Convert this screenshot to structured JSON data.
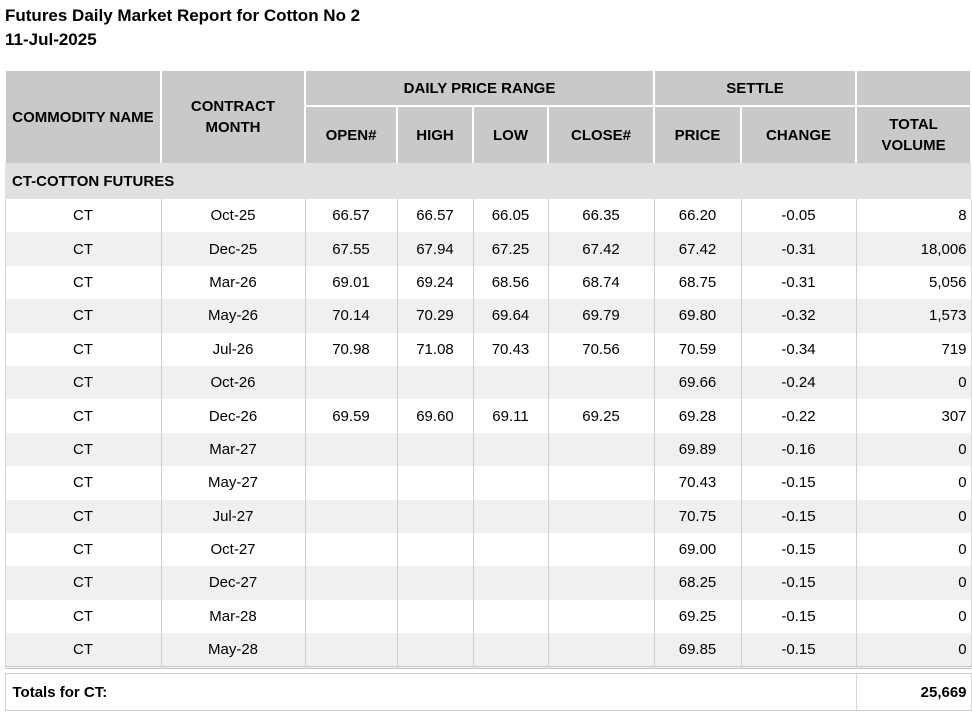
{
  "report": {
    "title": "Futures Daily Market Report for Cotton No 2",
    "date": "11-Jul-2025"
  },
  "table": {
    "headers": {
      "commodity_name": "COMMODITY NAME",
      "contract_month": "CONTRACT MONTH",
      "daily_price_range": "DAILY PRICE RANGE",
      "settle": "SETTLE",
      "total_volume": "TOTAL VOLUME",
      "open": "OPEN#",
      "high": "HIGH",
      "low": "LOW",
      "close": "CLOSE#",
      "price": "PRICE",
      "change": "CHANGE"
    },
    "section_label": "CT-COTTON FUTURES",
    "rows": [
      {
        "commodity": "CT",
        "month": "Oct-25",
        "open": "66.57",
        "high": "66.57",
        "low": "66.05",
        "close": "66.35",
        "price": "66.20",
        "change": "-0.05",
        "volume": "8"
      },
      {
        "commodity": "CT",
        "month": "Dec-25",
        "open": "67.55",
        "high": "67.94",
        "low": "67.25",
        "close": "67.42",
        "price": "67.42",
        "change": "-0.31",
        "volume": "18,006"
      },
      {
        "commodity": "CT",
        "month": "Mar-26",
        "open": "69.01",
        "high": "69.24",
        "low": "68.56",
        "close": "68.74",
        "price": "68.75",
        "change": "-0.31",
        "volume": "5,056"
      },
      {
        "commodity": "CT",
        "month": "May-26",
        "open": "70.14",
        "high": "70.29",
        "low": "69.64",
        "close": "69.79",
        "price": "69.80",
        "change": "-0.32",
        "volume": "1,573"
      },
      {
        "commodity": "CT",
        "month": "Jul-26",
        "open": "70.98",
        "high": "71.08",
        "low": "70.43",
        "close": "70.56",
        "price": "70.59",
        "change": "-0.34",
        "volume": "719"
      },
      {
        "commodity": "CT",
        "month": "Oct-26",
        "open": "",
        "high": "",
        "low": "",
        "close": "",
        "price": "69.66",
        "change": "-0.24",
        "volume": "0"
      },
      {
        "commodity": "CT",
        "month": "Dec-26",
        "open": "69.59",
        "high": "69.60",
        "low": "69.11",
        "close": "69.25",
        "price": "69.28",
        "change": "-0.22",
        "volume": "307"
      },
      {
        "commodity": "CT",
        "month": "Mar-27",
        "open": "",
        "high": "",
        "low": "",
        "close": "",
        "price": "69.89",
        "change": "-0.16",
        "volume": "0"
      },
      {
        "commodity": "CT",
        "month": "May-27",
        "open": "",
        "high": "",
        "low": "",
        "close": "",
        "price": "70.43",
        "change": "-0.15",
        "volume": "0"
      },
      {
        "commodity": "CT",
        "month": "Jul-27",
        "open": "",
        "high": "",
        "low": "",
        "close": "",
        "price": "70.75",
        "change": "-0.15",
        "volume": "0"
      },
      {
        "commodity": "CT",
        "month": "Oct-27",
        "open": "",
        "high": "",
        "low": "",
        "close": "",
        "price": "69.00",
        "change": "-0.15",
        "volume": "0"
      },
      {
        "commodity": "CT",
        "month": "Dec-27",
        "open": "",
        "high": "",
        "low": "",
        "close": "",
        "price": "68.25",
        "change": "-0.15",
        "volume": "0"
      },
      {
        "commodity": "CT",
        "month": "Mar-28",
        "open": "",
        "high": "",
        "low": "",
        "close": "",
        "price": "69.25",
        "change": "-0.15",
        "volume": "0"
      },
      {
        "commodity": "CT",
        "month": "May-28",
        "open": "",
        "high": "",
        "low": "",
        "close": "",
        "price": "69.85",
        "change": "-0.15",
        "volume": "0"
      }
    ],
    "totals": {
      "label": "Totals for CT:",
      "volume": "25,669"
    }
  }
}
